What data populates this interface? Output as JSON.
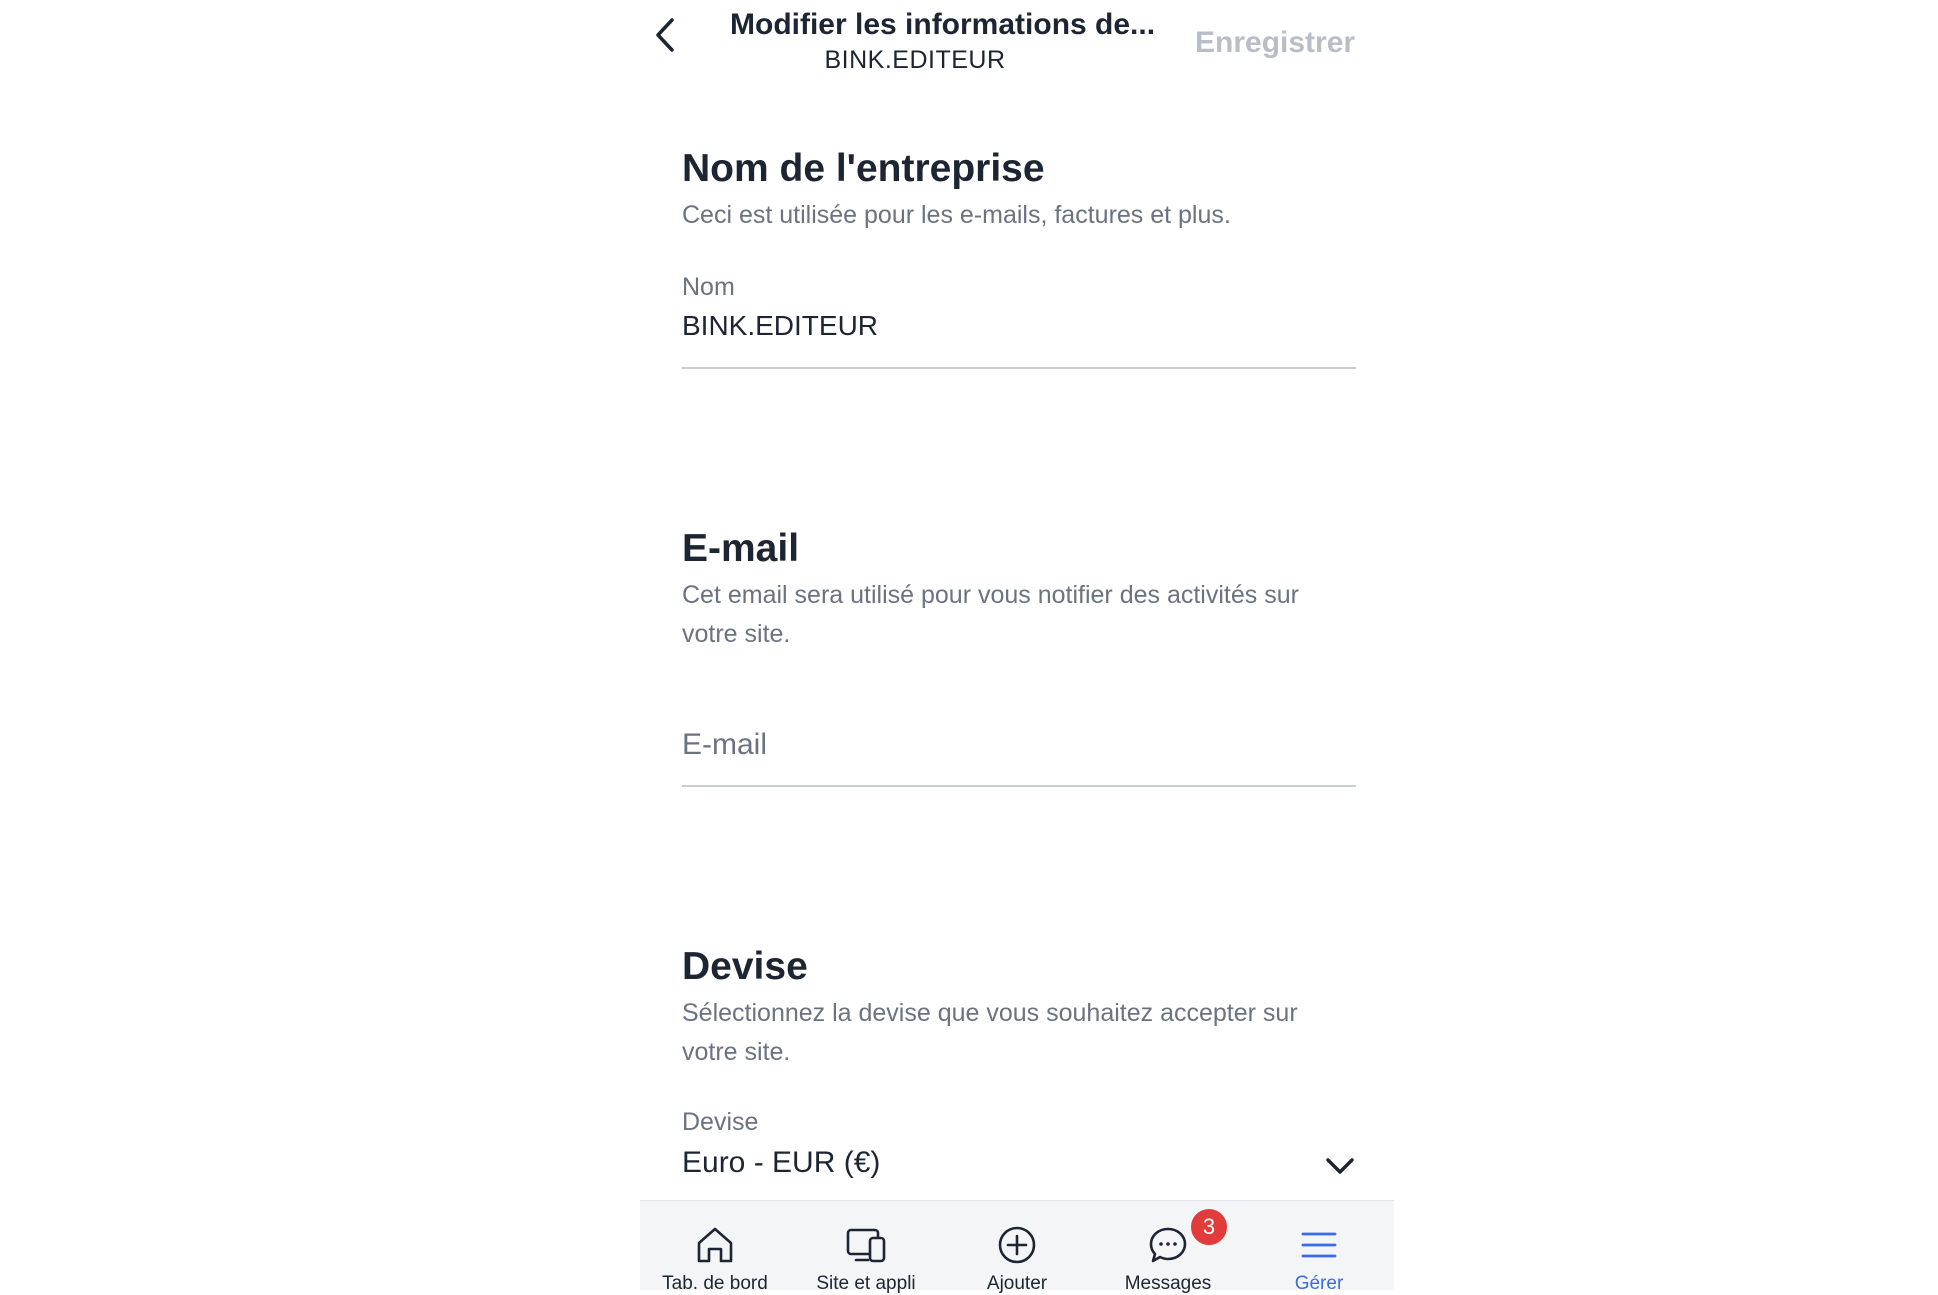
{
  "header": {
    "title": "Modifier les informations de...",
    "subtitle": "BINK.EDITEUR",
    "save_label": "Enregistrer"
  },
  "business_name": {
    "title": "Nom de l'entreprise",
    "description": "Ceci est utilisée pour les e-mails, factures et plus.",
    "field_label": "Nom",
    "field_value": "BINK.EDITEUR"
  },
  "email": {
    "title": "E-mail",
    "description": "Cet email sera utilisé pour vous notifier des activités sur votre site.",
    "placeholder": "E-mail"
  },
  "currency": {
    "title": "Devise",
    "description": "Sélectionnez la devise que vous souhaitez accepter sur votre site.",
    "field_label": "Devise",
    "selected": "Euro - EUR (€)"
  },
  "tabbar": {
    "tabs": [
      {
        "label": "Tab. de bord",
        "icon": "home-icon"
      },
      {
        "label": "Site et appli",
        "icon": "devices-icon"
      },
      {
        "label": "Ajouter",
        "icon": "add-circle-icon"
      },
      {
        "label": "Messages",
        "icon": "chat-icon",
        "badge": "3"
      },
      {
        "label": "Gérer",
        "icon": "menu-icon",
        "active": true
      }
    ]
  },
  "colors": {
    "text": "#1d2533",
    "muted": "#6b7280",
    "disabled": "#b9bec6",
    "accent": "#3b6ae6",
    "badge": "#e23b3b"
  }
}
